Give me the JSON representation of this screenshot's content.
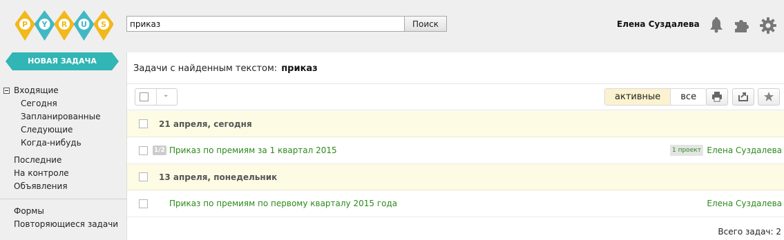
{
  "logo": {
    "letters": [
      "P",
      "Y",
      "R",
      "U",
      "S"
    ],
    "colors": [
      "#f2b81c",
      "#41b8c4",
      "#f2b81c",
      "#41b8c4",
      "#f2b81c"
    ]
  },
  "search": {
    "value": "приказ",
    "button_label": "Поиск"
  },
  "header": {
    "user_name": "Елена Суздалева",
    "icons": [
      "bell-icon",
      "puzzle-icon",
      "gear-icon"
    ]
  },
  "sidebar": {
    "new_task_label": "НОВАЯ ЗАДАЧА",
    "inbox_label": "Входящие",
    "inbox_items": [
      "Сегодня",
      "Запланированные",
      "Следующие",
      "Когда-нибудь"
    ],
    "items": [
      "Последние",
      "На контроле",
      "Объявления"
    ],
    "items2": [
      "Формы",
      "Повторяющиеся задачи"
    ]
  },
  "main": {
    "title_prefix": "Задачи с найденным текстом:",
    "title_query": "приказ",
    "filter_active": "активные",
    "filter_all": "все",
    "groups": [
      {
        "label": "21 апреля, сегодня",
        "tasks": [
          {
            "count": "1/2",
            "title": "Приказ по премиям за 1 квартал 2015",
            "badge": "1 проект",
            "responsible": "Елена Суздалева"
          }
        ]
      },
      {
        "label": "13 апреля, понедельник",
        "tasks": [
          {
            "count": "",
            "title": "Приказ по премиям по первому кварталу 2015 года",
            "badge": "",
            "responsible": "Елена Суздалева"
          }
        ]
      }
    ],
    "total": "Всего задач: 2"
  },
  "colors": {
    "accent_teal": "#31b5b5",
    "link_green": "#2b8a1a",
    "group_bg": "#fdfbe4"
  }
}
